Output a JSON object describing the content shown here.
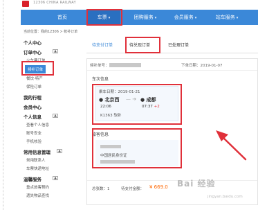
{
  "header": {
    "brand": "12306 CHINA RAILWAY",
    "nav": [
      "首页",
      "车票",
      "团购服务",
      "会员服务",
      "站车服务"
    ]
  },
  "breadcrumb": "当前位置：我的12306 > 帐补订单",
  "sidebar": {
    "personal_center": "个人中心",
    "order_center": "订单中心",
    "toggle": "▲",
    "items_order": [
      "火车票订单",
      "候补订单",
      "餐饮·特产",
      "保险订单"
    ],
    "my_trip": "我的行程",
    "member_center": "会员中心",
    "personal_info": "个人信息",
    "items_info": [
      "查看个人信息",
      "账号安全",
      "手机核验"
    ],
    "common_info": "常用信息管理",
    "items_common": [
      "常用联系人",
      "车票快递地址"
    ],
    "warm_service": "温馨服务",
    "items_warm": [
      "重点旅客预约",
      "遗失物品查找"
    ]
  },
  "tabs": [
    "待支付订单",
    "待兑现订单",
    "已处理订单"
  ],
  "order": {
    "no_label": "候补单号：",
    "order_date_label": "下单日期：",
    "order_date": "2019-01-07",
    "trip_section": "车次信息",
    "ride_date": "乘车日期：2019-01-21",
    "from": "北京西",
    "to": "成都",
    "dep_time": "22:06",
    "arr_time": "07:37",
    "plus_day": "+2",
    "train_info": "K1363 软卧",
    "passenger_section": "旅客信息",
    "id_type": "中国居民身份证",
    "total_label": "总张数：",
    "total_count": "1",
    "amount_label": "待支付金额：",
    "amount": "¥ 669.0"
  },
  "watermark": "Bai 经验",
  "watermark_sub": "jingyan.baidu.com",
  "colors": {
    "nav": "#3b88d8",
    "red": "#e0303a",
    "price": "#ff6600"
  }
}
